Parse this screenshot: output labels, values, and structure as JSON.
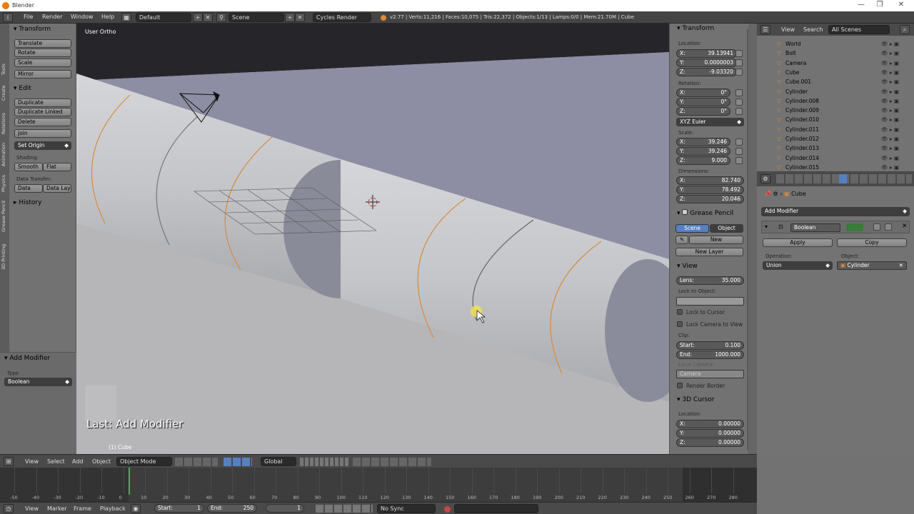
{
  "window": {
    "title": "Blender",
    "minimize": "—",
    "maximize": "❐",
    "close": "✕"
  },
  "info_header": {
    "menus": [
      "File",
      "Render",
      "Window",
      "Help"
    ],
    "screen_layout": "Default",
    "scene": "Scene",
    "render_engine": "Cycles Render",
    "stats": "v2.77 | Verts:11,216 | Faces:10,075 | Tris:22,372 | Objects:1/13 | Lamps:0/0 | Mem:21.70M | Cube"
  },
  "tool_tabs": [
    "Tools",
    "Create",
    "Relations",
    "Animation",
    "Physics",
    "Grease Pencil",
    "3D Printing"
  ],
  "tool_shelf": {
    "transform": {
      "header": "Transform",
      "buttons": [
        "Translate",
        "Rotate",
        "Scale",
        "Mirror"
      ]
    },
    "edit": {
      "header": "Edit",
      "buttons": [
        "Duplicate",
        "Duplicate Linked",
        "Delete",
        "Join"
      ],
      "set_origin": "Set Origin",
      "shading_label": "Shading:",
      "smooth": "Smooth",
      "flat": "Flat",
      "data_transfer_label": "Data Transfer:",
      "data": "Data",
      "data_lay": "Data Lay"
    },
    "history": {
      "header": "History"
    }
  },
  "operator_panel": {
    "header": "Add Modifier",
    "type_label": "Type",
    "type_value": "Boolean"
  },
  "viewport": {
    "view_name": "User Ortho",
    "last_op": "Last: Add Modifier",
    "object_info": "(1) Cube"
  },
  "properties_n": {
    "transform": {
      "header": "Transform",
      "location_label": "Location:",
      "location": [
        {
          "k": "X:",
          "v": "39.13941"
        },
        {
          "k": "Y:",
          "v": "0.0000003"
        },
        {
          "k": "Z:",
          "v": "-9.03320"
        }
      ],
      "rotation_label": "Rotation:",
      "rotation": [
        {
          "k": "X:",
          "v": "0°"
        },
        {
          "k": "Y:",
          "v": "0°"
        },
        {
          "k": "Z:",
          "v": "0°"
        }
      ],
      "rotation_mode": "XYZ Euler",
      "scale_label": "Scale:",
      "scale": [
        {
          "k": "X:",
          "v": "39.246"
        },
        {
          "k": "Y:",
          "v": "39.246"
        },
        {
          "k": "Z:",
          "v": "9.000"
        }
      ],
      "dimensions_label": "Dimensions:",
      "dimensions": [
        {
          "k": "X:",
          "v": "82.740"
        },
        {
          "k": "Y:",
          "v": "78.492"
        },
        {
          "k": "Z:",
          "v": "20.046"
        }
      ]
    },
    "grease_pencil": {
      "header": "Grease Pencil",
      "scene": "Scene",
      "object": "Object",
      "new": "New",
      "new_layer": "New Layer"
    },
    "view": {
      "header": "View",
      "lens_label": "Lens:",
      "lens": "35.000",
      "lock_to_object": "Lock to Object:",
      "lock_to_cursor": "Lock to Cursor",
      "lock_camera": "Lock Camera to View",
      "clip_label": "Clip:",
      "clip_start_label": "Start:",
      "clip_start": "0.100",
      "clip_end_label": "End:",
      "clip_end": "1000.000",
      "local_camera_label": "Local Camera:",
      "local_camera": "Camera",
      "render_border": "Render Border"
    },
    "cursor": {
      "header": "3D Cursor",
      "location_label": "Location:",
      "loc": [
        {
          "k": "X:",
          "v": "0.00000"
        },
        {
          "k": "Y:",
          "v": "0.00000"
        },
        {
          "k": "Z:",
          "v": "0.00000"
        }
      ]
    }
  },
  "outliner": {
    "menus": [
      "View",
      "Search"
    ],
    "filter": "All Scenes",
    "items": [
      "World",
      "Bolt",
      "Camera",
      "Cube",
      "Cube.001",
      "Cylinder",
      "Cylinder.008",
      "Cylinder.009",
      "Cylinder.010",
      "Cylinder.011",
      "Cylinder.012",
      "Cylinder.013",
      "Cylinder.014",
      "Cylinder.015"
    ]
  },
  "properties_editor": {
    "breadcrumb": "Cube",
    "add_modifier": "Add Modifier",
    "modifier_name": "Boolean",
    "apply": "Apply",
    "copy": "Copy",
    "operation_label": "Operation:",
    "operation": "Union",
    "object_label": "Object:",
    "object": "Cylinder"
  },
  "viewport_header": {
    "menus": [
      "View",
      "Select",
      "Add",
      "Object"
    ],
    "mode": "Object Mode",
    "orientation": "Global"
  },
  "timeline": {
    "ticks": [
      "-50",
      "-40",
      "-30",
      "-20",
      "-10",
      "0",
      "10",
      "20",
      "30",
      "40",
      "50",
      "60",
      "70",
      "80",
      "90",
      "100",
      "110",
      "120",
      "130",
      "140",
      "150",
      "160",
      "170",
      "180",
      "190",
      "200",
      "210",
      "220",
      "230",
      "240",
      "250",
      "260",
      "270",
      "280"
    ],
    "menus": [
      "View",
      "Marker",
      "Frame",
      "Playback"
    ],
    "start_label": "Start:",
    "start": "1",
    "end_label": "End:",
    "end": "250",
    "current": "1",
    "sync": "No Sync"
  }
}
